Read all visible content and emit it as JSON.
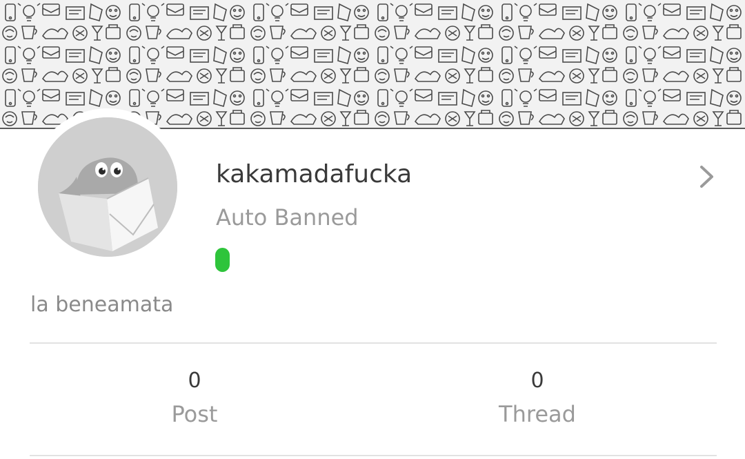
{
  "profile": {
    "username": "kakamadafucka",
    "rank": "Auto Banned",
    "signature": "la beneamata",
    "status_color": "#2ec43b"
  },
  "stats": [
    {
      "value": "0",
      "label": "Post"
    },
    {
      "value": "0",
      "label": "Thread"
    }
  ],
  "icons": {
    "header": "doodle-pattern-banner",
    "avatar": "default-avatar-ghost-in-box",
    "navigate": "chevron-right-icon"
  }
}
